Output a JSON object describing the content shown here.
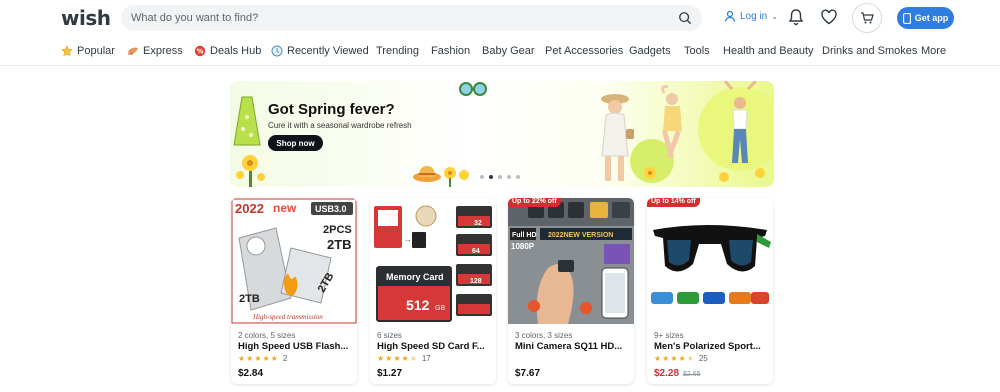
{
  "header": {
    "logo": "wish",
    "search_placeholder": "What do you want to find?",
    "login_label": "Log in",
    "get_app_label": "Get app"
  },
  "nav": {
    "items": [
      {
        "label": "Popular",
        "icon": "star-icon"
      },
      {
        "label": "Express",
        "icon": "express-icon"
      },
      {
        "label": "Deals Hub",
        "icon": "deals-icon"
      },
      {
        "label": "Recently Viewed",
        "icon": "clock-icon"
      },
      {
        "label": "Trending"
      },
      {
        "label": "Fashion"
      },
      {
        "label": "Baby Gear"
      },
      {
        "label": "Pet Accessories"
      },
      {
        "label": "Gadgets"
      },
      {
        "label": "Tools"
      },
      {
        "label": "Health and Beauty"
      },
      {
        "label": "Drinks and Smokes"
      },
      {
        "label": "More"
      }
    ]
  },
  "banner": {
    "title": "Got Spring fever?",
    "subtitle": "Cure it with a seasonal wardrobe refresh",
    "button": "Shop now",
    "slide_count": 5,
    "active_slide": 2
  },
  "products": [
    {
      "meta": "2 colors, 5 sizes",
      "title": "High Speed USB Flash...",
      "rating": 5,
      "reviews": "2",
      "price": "$2.84",
      "promo": "",
      "image_text": [
        "2022",
        "new",
        "USB3.0",
        "2PCS",
        "2TB",
        "2TB",
        "2TB",
        "High-speed transmission"
      ]
    },
    {
      "meta": "6 sizes",
      "title": "High Speed SD Card F...",
      "rating": 4.5,
      "reviews": "17",
      "price": "$1.27",
      "promo": "",
      "image_text": [
        "Memory Card",
        "512",
        "GB",
        "32",
        "64",
        "128"
      ]
    },
    {
      "meta": "3 colors, 3 sizes",
      "title": "Mini Camera SQ11 HD...",
      "rating": 0,
      "reviews": "",
      "price": "$7.67",
      "promo": "Up to 22% off",
      "image_text": [
        "Full HD",
        "1080P",
        "2022NEW VERSION"
      ]
    },
    {
      "meta": "9+ sizes",
      "title": "Men's Polarized Sport...",
      "rating": 4.5,
      "reviews": "25",
      "price": "$2.28",
      "old_price": "$2.65",
      "promo": "Up to 14% off",
      "image_text": []
    }
  ],
  "colors": {
    "accent": "#2f7de1",
    "sale": "#d32f2f",
    "star": "#f5a623"
  }
}
